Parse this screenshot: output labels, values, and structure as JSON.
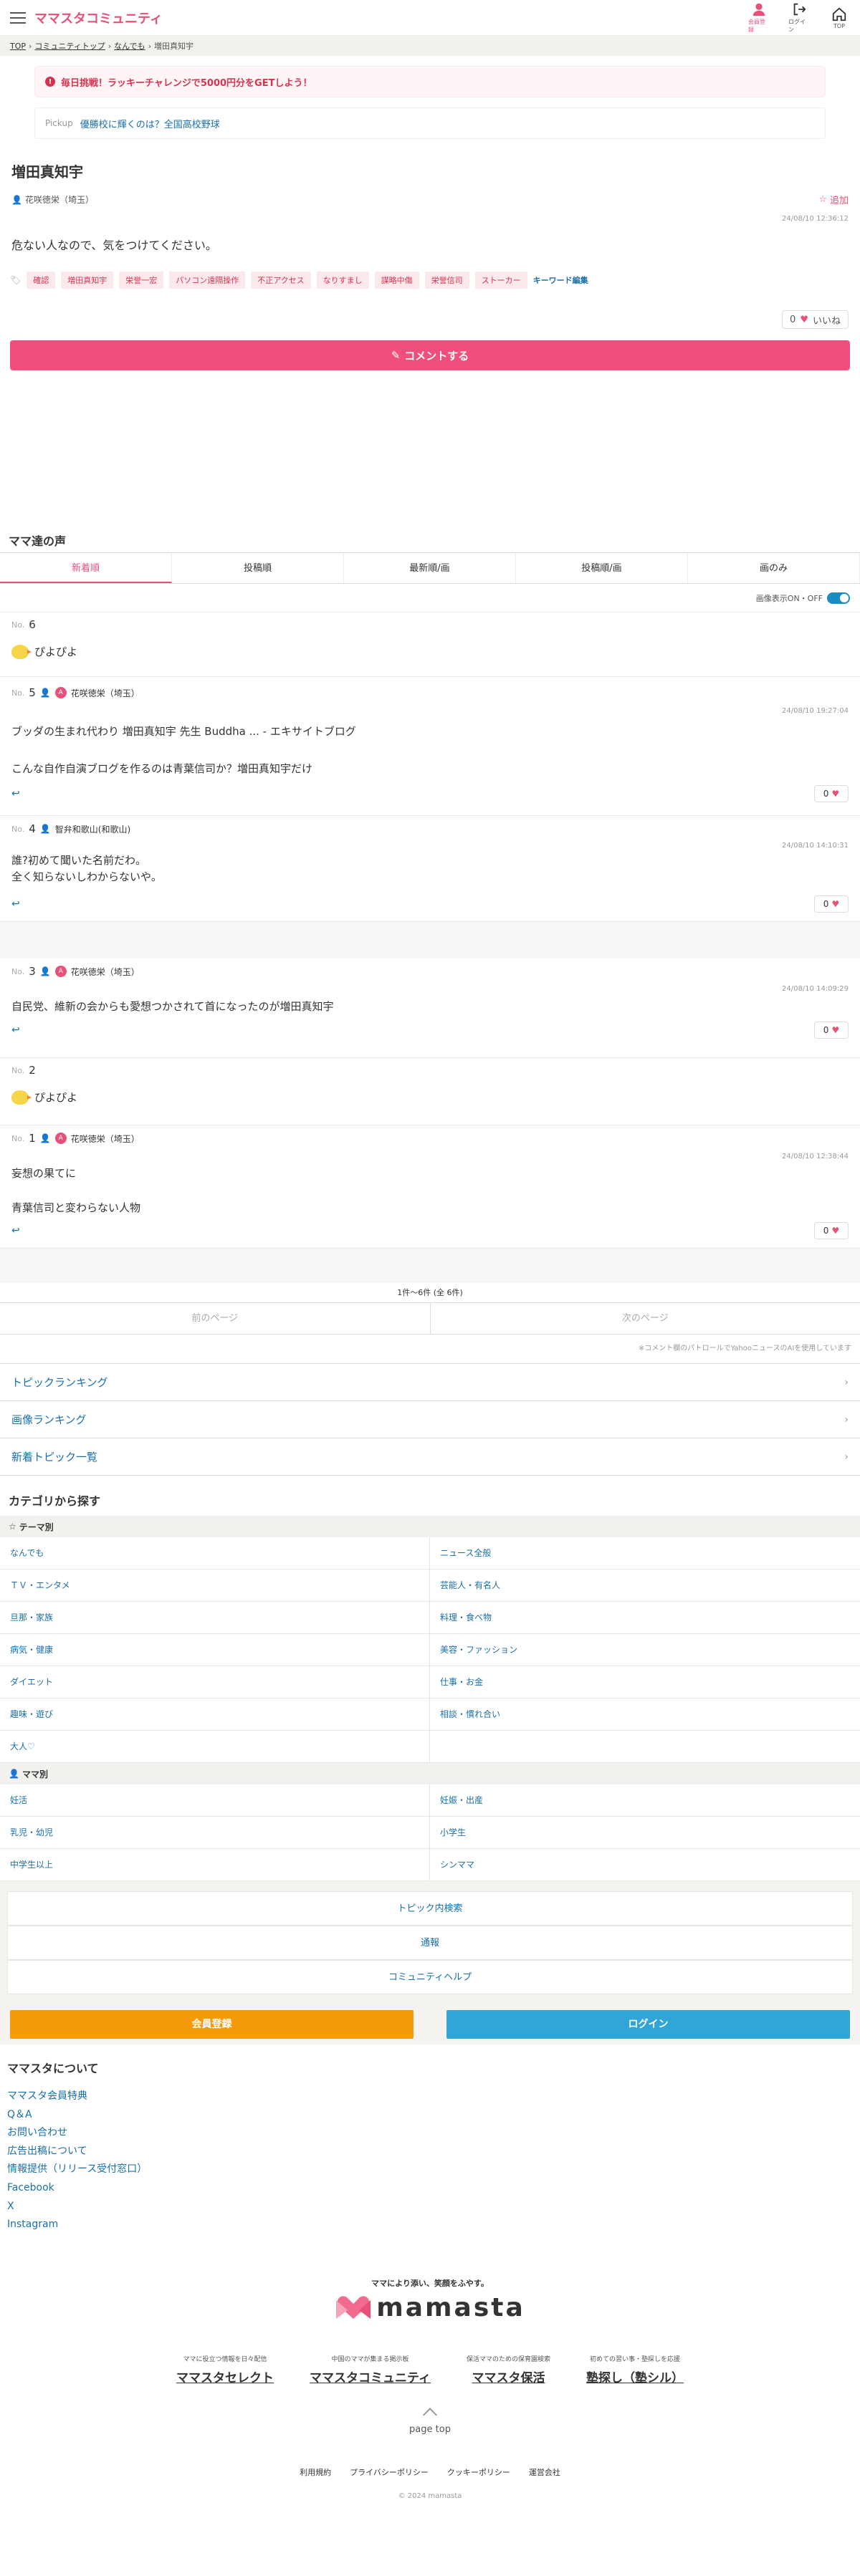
{
  "header": {
    "logo": "ママスタコミュニティ",
    "icons": [
      {
        "name": "会員登録",
        "icon": "user-icon"
      },
      {
        "name": "ログイン",
        "icon": "login-icon"
      },
      {
        "name": "TOP",
        "icon": "home-icon"
      }
    ]
  },
  "breadcrumb": [
    "TOP",
    "コミュニティトップ",
    "なんでも",
    "増田真知宇"
  ],
  "banner_alert": "毎日挑戦！ラッキーチャレンジで5000円分をGETしよう！",
  "banner_pickup": {
    "label": "Pickup",
    "text": "優勝校に輝くのは？全国高校野球"
  },
  "topic": {
    "title": "増田真知宇",
    "author": "花咲徳栄（埼玉）",
    "add_label": "追加",
    "date": "24/08/10 12:36:12",
    "body": "危ない人なので、気をつけてください。",
    "tags": [
      "確認",
      "増田真知宇",
      "栄誉一宏",
      "パソコン遠隔操作",
      "不正アクセス",
      "なりすまし",
      "謀略中傷",
      "栄誉信司",
      "ストーカー"
    ],
    "more_label": "キーワード編集",
    "likes": "0",
    "like_label": "いいね",
    "comment_btn": "コメントする"
  },
  "section_title": "ママ達の声",
  "sort_tabs": [
    "新着順",
    "投稿順",
    "最新順/画",
    "投稿順/画",
    "画のみ"
  ],
  "img_toggle": "画像表示ON・OFF",
  "comments": [
    {
      "no": "No.",
      "num": "6",
      "author": "",
      "date": "",
      "text": "ぴよぴよ",
      "kind": "piyo"
    },
    {
      "no": "No.",
      "num": "5",
      "author": "花咲徳栄（埼玉）",
      "date": "24/08/10 19:27:04",
      "text": "ブッダの生まれ代わり 増田真知宇 先生 Buddha ... - エキサイトブログ\n\nこんな自作自演ブログを作るのは青葉信司か？増田真知宇だけ",
      "likes": "0",
      "kind": "text"
    },
    {
      "no": "No.",
      "num": "4",
      "author": "智弁和歌山(和歌山)",
      "date": "24/08/10 14:10:31",
      "text": "誰?初めて聞いた名前だわ。\n全く知らないしわからないや。",
      "likes": "0",
      "kind": "text"
    },
    {
      "no": "No.",
      "num": "3",
      "author": "花咲徳栄（埼玉）",
      "date": "24/08/10 14:09:29",
      "text": "自民党、維新の会からも愛想つかされて首になったのが増田真知宇",
      "likes": "0",
      "kind": "text"
    },
    {
      "no": "No.",
      "num": "2",
      "author": "",
      "date": "",
      "text": "ぴよぴよ",
      "kind": "piyo"
    },
    {
      "no": "No.",
      "num": "1",
      "author": "花咲徳栄（埼玉）",
      "date": "24/08/10 12:38:44",
      "text": "妄想の果てに\n\n青葉信司と変わらない人物",
      "likes": "0",
      "kind": "text"
    }
  ],
  "pagination": {
    "info": "1件～6件 (全 6件)",
    "prev": "前のページ",
    "next": "次のページ"
  },
  "note": "※コメント欄のパトロールでYahooニュースのAIを使用しています",
  "rank_links": [
    "トピックランキング",
    "画像ランキング",
    "新着トピック一覧"
  ],
  "category": {
    "title": "カテゴリから探す",
    "theme_label": "テーマ別",
    "theme_items": [
      "なんでも",
      "ニュース全般",
      "ＴＶ・エンタメ",
      "芸能人・有名人",
      "旦那・家族",
      "料理・食べ物",
      "病気・健康",
      "美容・ファッション",
      "ダイエット",
      "仕事・お金",
      "趣味・遊び",
      "相談・慣れ合い",
      "大人♡",
      ""
    ],
    "mama_label": "ママ別",
    "mama_items": [
      "妊活",
      "妊娠・出産",
      "乳児・幼児",
      "小学生",
      "中学生以上",
      "シンママ"
    ]
  },
  "bottom_links": [
    "トピック内検索",
    "通報",
    "コミュニティヘルプ"
  ],
  "auth": {
    "register": "会員登録",
    "login": "ログイン",
    "register_color": "#f59a0b",
    "login_color": "#31a4d8"
  },
  "about": {
    "title": "ママスタについて",
    "items": [
      "ママスタ会員特典",
      "Q＆A",
      "お問い合わせ",
      "広告出稿について",
      "情報提供（リリース受付窓口）",
      "Facebook",
      "X",
      "Instagram"
    ]
  },
  "brand": {
    "tagline": "ママにより添い、笑顔をふやす。",
    "wordmark": "mamasta"
  },
  "sites": [
    {
      "desc": "ママに役立つ情報を日々配信",
      "name": "ママスタセレクト"
    },
    {
      "desc": "中国のママが集まる掲示板",
      "name": "ママスタコミュニティ"
    },
    {
      "desc": "保活ママのための保育園検索",
      "name": "ママスタ保活"
    },
    {
      "desc": "初めての習い事・塾探しを応援",
      "name": "塾探し（塾シル）"
    }
  ],
  "pagetop": "page top",
  "footer_links": [
    "利用規約",
    "プライバシーポリシー",
    "クッキーポリシー",
    "運営会社"
  ],
  "copyright": "© 2024 mamasta",
  "colors": {
    "accent": "#e8507a",
    "comment_button": "#f04f7c",
    "link": "#1a6fa8"
  }
}
